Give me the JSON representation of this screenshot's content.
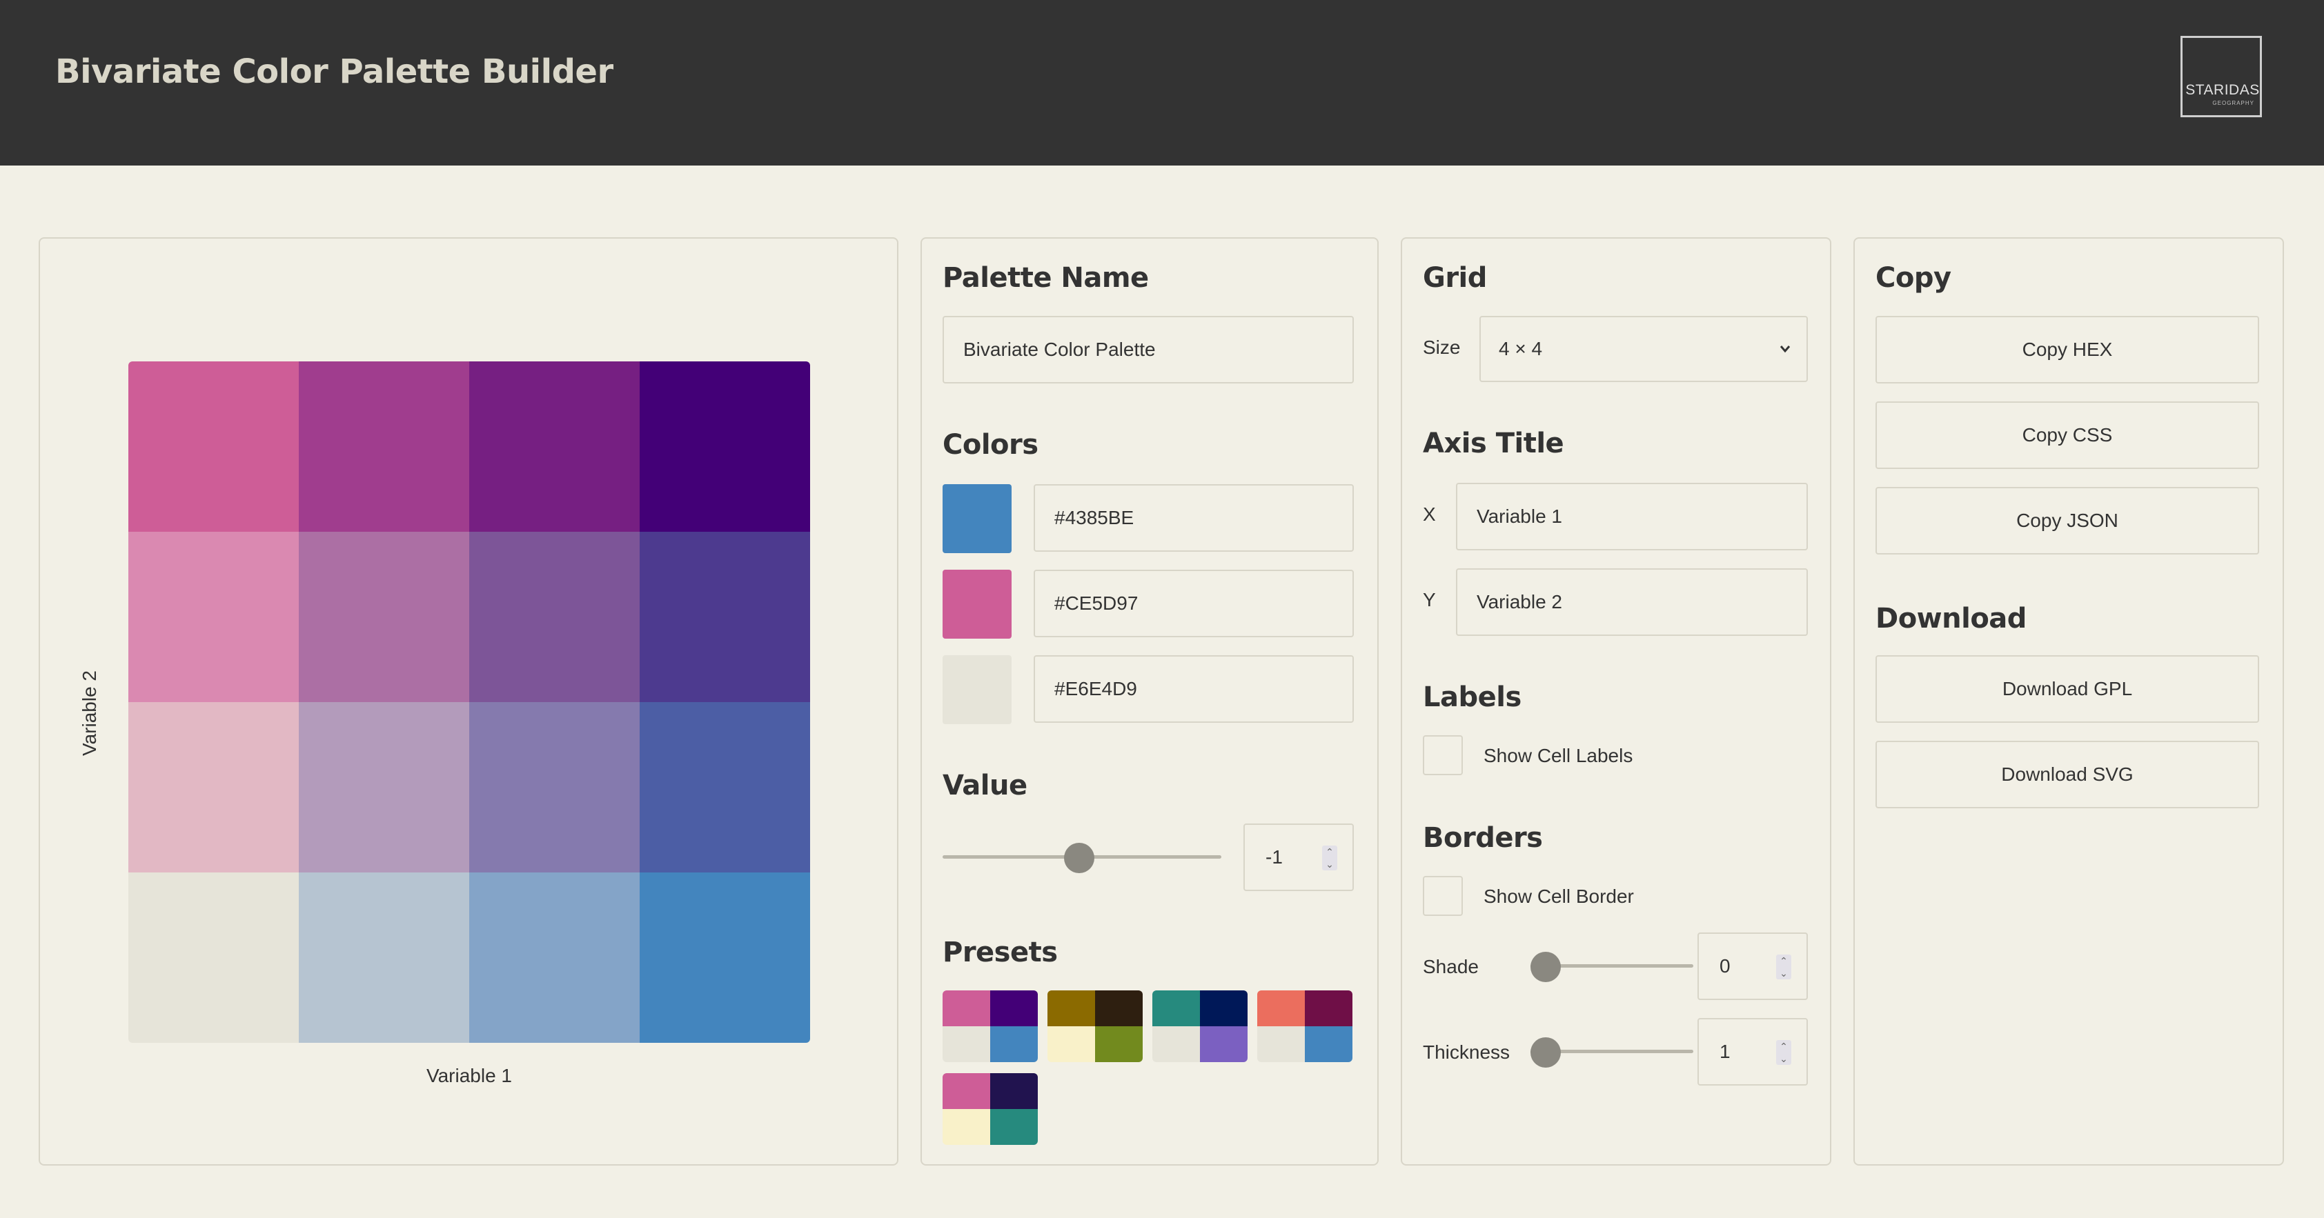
{
  "app": {
    "title": "Bivariate Color Palette Builder",
    "logo_text": "STARIDAS",
    "logo_subtext": "GEOGRAPHY"
  },
  "preview": {
    "x_axis_title": "Variable 1",
    "y_axis_title": "Variable 2",
    "rows": [
      [
        "#CE5D97",
        "#A03D8E",
        "#761F82",
        "#430077"
      ],
      [
        "#DA89B1",
        "#AC6FA4",
        "#7D5598",
        "#4D3A8F"
      ],
      [
        "#E2B8C4",
        "#B39BBB",
        "#857AAE",
        "#4C5EA5"
      ],
      [
        "#E6E4D9",
        "#B6C4D1",
        "#84A4C8",
        "#4385BE"
      ]
    ]
  },
  "palette": {
    "name_heading": "Palette Name",
    "name_value": "Bivariate Color Palette",
    "colors_heading": "Colors",
    "colors": [
      {
        "hex": "#4385BE"
      },
      {
        "hex": "#CE5D97"
      },
      {
        "hex": "#E6E4D9"
      }
    ],
    "value_heading": "Value",
    "value": "-1",
    "value_slider_fraction": 0.49,
    "presets_heading": "Presets",
    "presets": [
      [
        "#CE5D97",
        "#430077",
        "#E6E4D9",
        "#4385BE"
      ],
      [
        "#8B6A00",
        "#2E1F10",
        "#F9F1C9",
        "#728A1E"
      ],
      [
        "#268A7E",
        "#001858",
        "#E6E4D9",
        "#7B60C1"
      ],
      [
        "#EB6E5E",
        "#6F0F47",
        "#E6E4D9",
        "#4385BE"
      ],
      [
        "#CE5D97",
        "#21134F",
        "#F9F1C9",
        "#268A7E"
      ]
    ]
  },
  "grid": {
    "heading": "Grid",
    "size_label": "Size",
    "size_value": "4 × 4",
    "axis_heading": "Axis Title",
    "x_label": "X",
    "x_value": "Variable 1",
    "y_label": "Y",
    "y_value": "Variable 2",
    "labels_heading": "Labels",
    "show_cell_labels": "Show Cell Labels",
    "borders_heading": "Borders",
    "show_cell_border": "Show Cell Border",
    "shade_label": "Shade",
    "shade_value": "0",
    "thickness_label": "Thickness",
    "thickness_value": "1"
  },
  "copy": {
    "heading": "Copy",
    "buttons": [
      "Copy HEX",
      "Copy CSS",
      "Copy JSON"
    ],
    "download_heading": "Download",
    "download_buttons": [
      "Download GPL",
      "Download SVG"
    ]
  }
}
